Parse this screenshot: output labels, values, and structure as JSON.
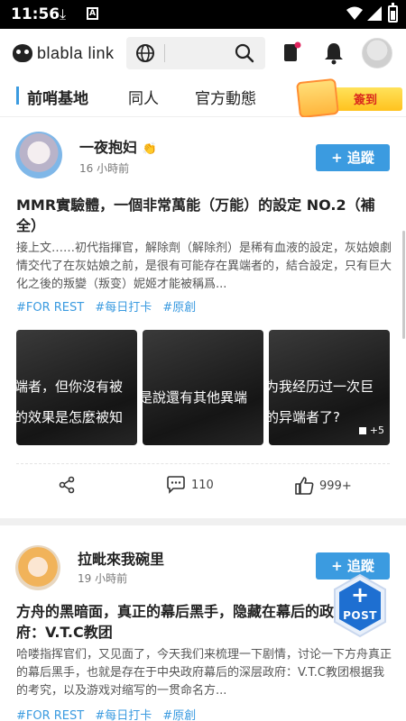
{
  "status_bar": {
    "time": "11:56"
  },
  "app": {
    "logo_text": "blabla link"
  },
  "search": {
    "placeholder": ""
  },
  "tabs": [
    {
      "label": "前哨基地",
      "active": true
    },
    {
      "label": "同人",
      "active": false
    },
    {
      "label": "官方動態",
      "active": false
    }
  ],
  "signin": {
    "label": "簽到"
  },
  "posts": [
    {
      "author": "一夜抱妇",
      "author_badge": "👏",
      "time": "16 小時前",
      "follow_label": "+ 追蹤",
      "title": "MMR實驗體，一個非常萬能（万能）的設定 NO.2（補全）",
      "excerpt": "接上文……初代指揮官，解除劑（解除剂）是稀有血液的設定，灰姑娘劇情交代了在灰姑娘之前，是很有可能存在異端者的，結合設定，只有巨大化之後的叛變（叛变）妮姬才能被稱爲...",
      "tags": [
        "#FOR REST",
        "#每日打卡",
        "#原創"
      ],
      "thumbs": [
        {
          "line1": "端者，但你沒有被",
          "line2": "的效果是怎麼被知"
        },
        {
          "line1": "是說還有其他異端",
          "line2": ""
        },
        {
          "line1": "为我经历过一次巨",
          "line2": "的异端者了?",
          "more": "+5"
        }
      ],
      "share_label": "",
      "comments": "110",
      "likes": "999+"
    },
    {
      "author": "拉毗來我碗里",
      "time": "19 小時前",
      "follow_label": "+ 追蹤",
      "title": "方舟的黑暗面，真正的幕后黑手，隐藏在幕后的政府：V.T.C教团",
      "excerpt": "哈喽指挥官们，又见面了，今天我们来梳理一下剧情，讨论一下方舟真正的幕后黑手，也就是存在于中央政府幕后的深层政府：V.T.C教团根据我的考究，以及游戏对缩写的一贯命名方...",
      "tags": [
        "#FOR REST",
        "#每日打卡",
        "#原創"
      ]
    }
  ],
  "fab": {
    "label": "POST",
    "plus": "+"
  },
  "colors": {
    "accent": "#3b9be0",
    "signin_red": "#d9281d",
    "fab_dark": "#1e6fd1"
  }
}
